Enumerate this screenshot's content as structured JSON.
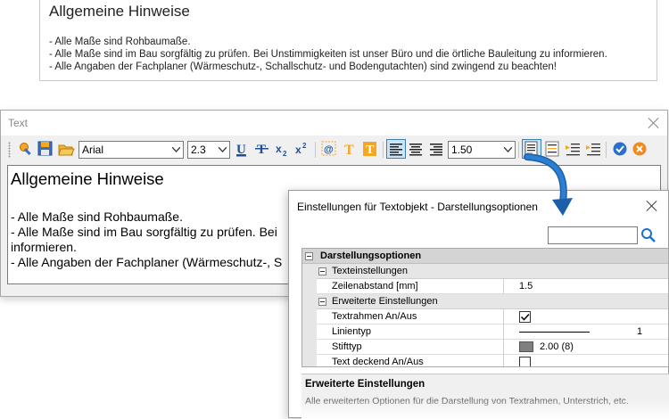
{
  "preview": {
    "title": "Allgemeine Hinweise",
    "lines": [
      "- Alle Maße sind Rohbaumaße.",
      "- Alle Maße sind im Bau sorgfältig zu prüfen. Bei Unstimmigkeiten ist unser Büro und die örtliche Bauleitung zu informieren.",
      "- Alle Angaben der Fachplaner (Wärmeschutz-, Schallschutz- und Bodengutachten) sind zwingend zu beachten!"
    ]
  },
  "text_window": {
    "title": "Text",
    "toolbar": {
      "font": "Arial",
      "size": "2.3",
      "line_spacing": "1.50"
    },
    "editor": {
      "title": "Allgemeine Hinweise",
      "lines": [
        "- Alle Maße sind Rohbaumaße.",
        "- Alle Maße sind im Bau sorgfältig zu prüfen. Bei",
        "informieren.",
        "- Alle Angaben der Fachplaner (Wärmeschutz-, S"
      ]
    }
  },
  "dialog": {
    "title": "Einstellungen für Textobjekt - Darstellungsoptionen",
    "search_value": "",
    "grid": {
      "category": "Darstellungsoptionen",
      "group1": "Texteinstellungen",
      "zeilenabstand_label": "Zeilenabstand [mm]",
      "zeilenabstand_value": "1.5",
      "group2": "Erweiterte Einstellungen",
      "textrahmen_label": "Textrahmen An/Aus",
      "textrahmen_checked": true,
      "linientyp_label": "Linientyp",
      "linientyp_value": "1",
      "stifttyp_label": "Stifttyp",
      "stifttyp_value": "2.00 (8)",
      "text_deckend_label": "Text deckend An/Aus",
      "text_deckend_checked": false
    },
    "description": {
      "title": "Erweiterte Einstellungen",
      "text": "Alle erweiterten Optionen für die Darstellung von Textrahmen, Unterstrich, etc."
    }
  },
  "colors": {
    "accent_blue": "#1a73c8",
    "checkmark_blue": "#2a6fc9",
    "close_orange": "#f08a1c",
    "highlight_orange": "#f5a623"
  }
}
